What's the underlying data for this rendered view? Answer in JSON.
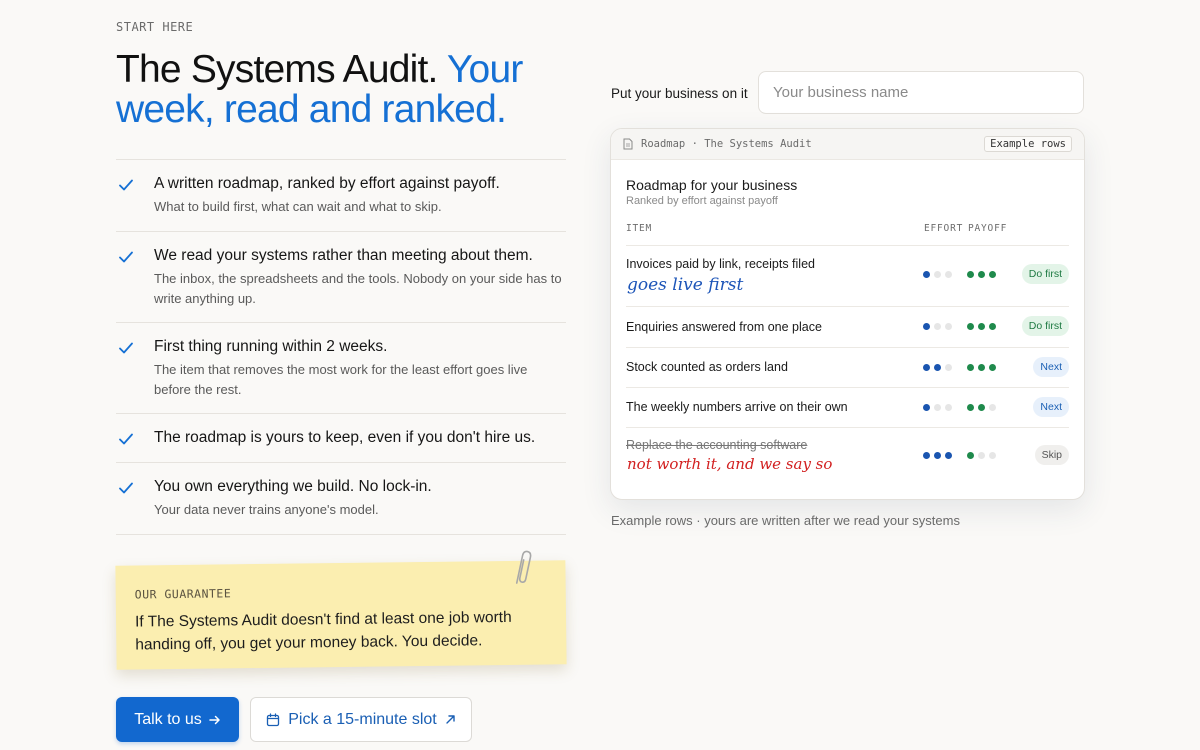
{
  "hero": {
    "eyebrow": "START HERE",
    "headline_main": "The Systems Audit.",
    "headline_accent": "Your week, read and ranked."
  },
  "features": [
    {
      "title": "A written roadmap, ranked by effort against payoff.",
      "desc": "What to build first, what can wait and what to skip."
    },
    {
      "title": "We read your systems rather than meeting about them.",
      "desc": "The inbox, the spreadsheets and the tools. Nobody on your side has to write anything up."
    },
    {
      "title": "First thing running within 2 weeks.",
      "desc": "The item that removes the most work for the least effort goes live before the rest."
    },
    {
      "title": "The roadmap is yours to keep, even if you don't hire us.",
      "desc": ""
    },
    {
      "title": "You own everything we build. No lock-in.",
      "desc": "Your data never trains anyone's model."
    }
  ],
  "guarantee": {
    "label": "OUR GUARANTEE",
    "text": "If The Systems Audit doesn't find at least one job worth handing off, you get your money back. You decide."
  },
  "cta": {
    "primary": "Talk to us",
    "primary_icon": "arrow-right-icon",
    "secondary": "Pick a 15-minute slot",
    "secondary_icon": "calendar-icon"
  },
  "business": {
    "label": "Put your business on it",
    "placeholder": "Your business name"
  },
  "card": {
    "breadcrumb": "Roadmap · The Systems Audit",
    "example_pill": "Example rows",
    "title": "Roadmap for your business",
    "subtitle": "Ranked by effort against payoff",
    "col_item": "ITEM",
    "col_effort": "EFFORT",
    "col_payoff": "PAYOFF"
  },
  "roadmap": [
    {
      "item": "Invoices paid by link, receipts filed",
      "note": "goes live first",
      "effort": 1,
      "payoff": 3,
      "badge": "Do first",
      "struck": false
    },
    {
      "item": "Enquiries answered from one place",
      "note": "",
      "effort": 1,
      "payoff": 3,
      "badge": "Do first",
      "struck": false
    },
    {
      "item": "Stock counted as orders land",
      "note": "",
      "effort": 2,
      "payoff": 3,
      "badge": "Next",
      "struck": false
    },
    {
      "item": "The weekly numbers arrive on their own",
      "note": "",
      "effort": 1,
      "payoff": 2,
      "badge": "Next",
      "struck": false
    },
    {
      "item": "Replace the accounting software",
      "note": "not worth it, and we say so",
      "effort": 3,
      "payoff": 1,
      "badge": "Skip",
      "struck": true
    }
  ],
  "caption": "Example rows · yours are written after we read your systems",
  "colors": {
    "accent": "#1570d4",
    "effort_dot": "#1a55b0",
    "payoff_dot": "#1f8a4c",
    "dot_empty": "#e6e6e6",
    "do_first_bg": "#e3f4e8",
    "do_first_fg": "#1f7a43",
    "next_bg": "#e7f0fb",
    "next_fg": "#1a5fb4",
    "skip_bg": "#f0efed",
    "skip_fg": "#555555",
    "note_blue": "#1d55b8",
    "note_red": "#d22020",
    "sticky": "#fbeeb0"
  }
}
